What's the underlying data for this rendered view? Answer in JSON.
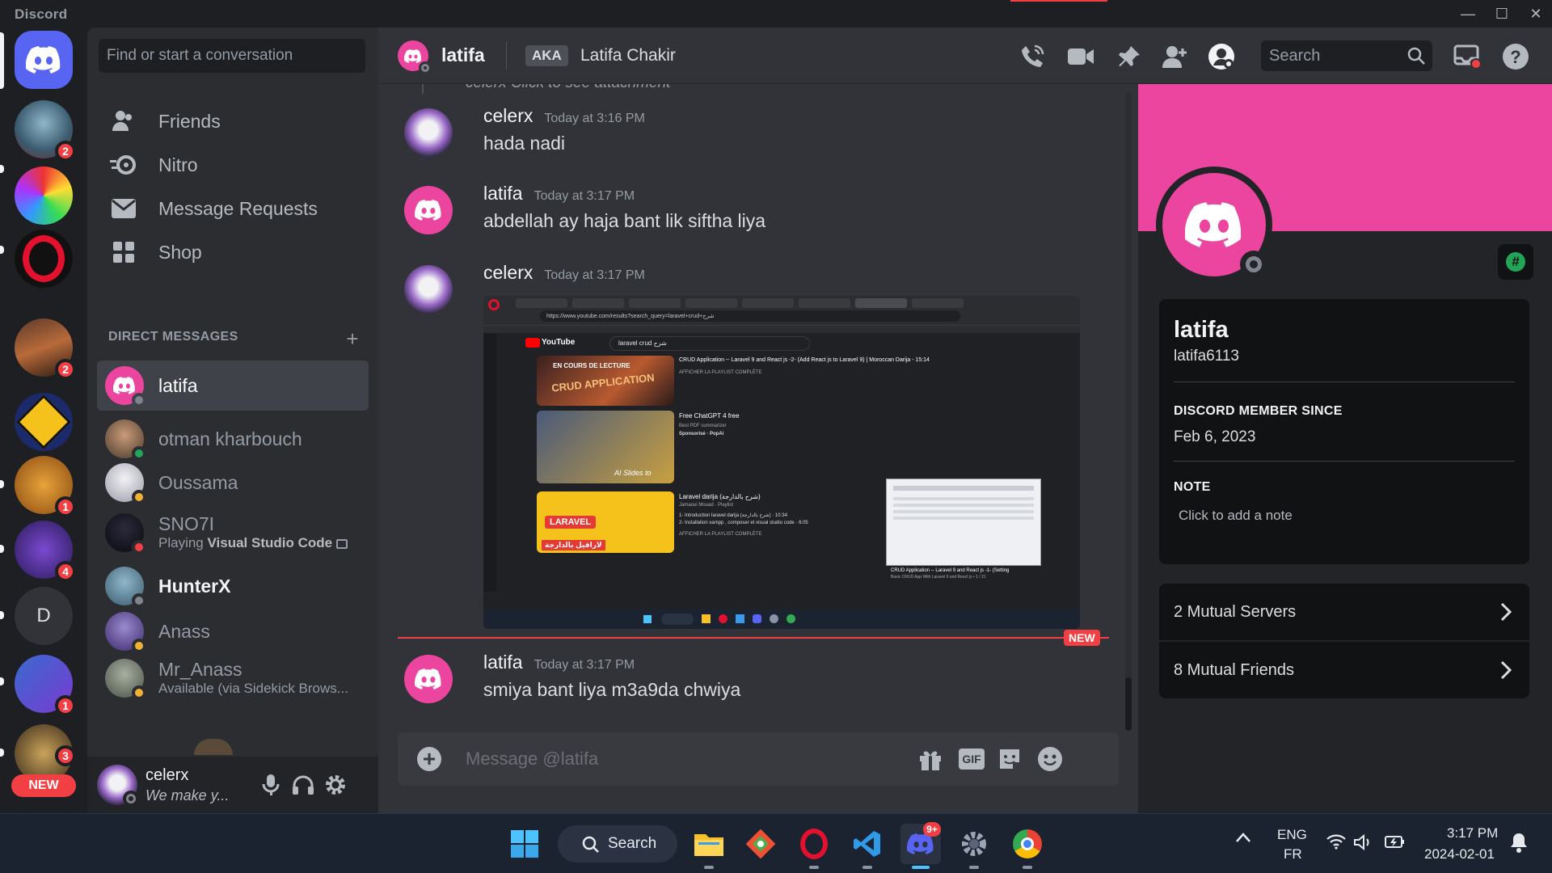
{
  "window": {
    "title": "Discord",
    "minimize": "—",
    "maximize": "☐",
    "close": "✕"
  },
  "rail": {
    "servers": [
      {
        "badge": "2"
      },
      {
        "badge": ""
      },
      {
        "badge": ""
      },
      {
        "badge": "2"
      },
      {
        "badge": ""
      },
      {
        "badge": "1"
      },
      {
        "badge": "4"
      },
      {
        "letter": "D"
      },
      {
        "badge": "1"
      },
      {
        "badge": "3"
      }
    ],
    "new_label": "NEW"
  },
  "sidebar": {
    "search_placeholder": "Find or start a conversation",
    "nav": [
      "Friends",
      "Nitro",
      "Message Requests",
      "Shop"
    ],
    "dm_header": "DIRECT MESSAGES",
    "dm_add": "+",
    "dms": [
      {
        "name": "latifa",
        "sub": ""
      },
      {
        "name": "otman kharbouch",
        "sub": ""
      },
      {
        "name": "Oussama",
        "sub": ""
      },
      {
        "name": "SNO7I",
        "sub_prefix": "Playing ",
        "sub_bold": "Visual Studio Code"
      },
      {
        "name": "HunterX",
        "sub": ""
      },
      {
        "name": "Anass",
        "sub": ""
      },
      {
        "name": "Mr_Anass",
        "sub": "Available (via Sidekick Brows..."
      }
    ]
  },
  "user_panel": {
    "name": "celerx",
    "status": "We make y..."
  },
  "header": {
    "name": "latifa",
    "aka_label": "AKA",
    "aka_name": "Latifa Chakir",
    "search_placeholder": "Search"
  },
  "messages": {
    "partial_top": "celerx  Click to see attachment",
    "items": [
      {
        "author": "celerx",
        "time": "Today at 3:16 PM",
        "text": "hada nadi"
      },
      {
        "author": "latifa",
        "time": "Today at 3:17 PM",
        "text": "abdellah ay haja bant lik siftha liya"
      },
      {
        "author": "celerx",
        "time": "Today at 3:17 PM",
        "text": ""
      },
      {
        "author": "latifa",
        "time": "Today at 3:17 PM",
        "text": "smiya bant liya m3a9da chwiya"
      }
    ],
    "new_label": "NEW"
  },
  "attachment": {
    "url": "https://www.youtube.com/results?search_query=laravel+crud+شرح",
    "search": "laravel crud شرح",
    "logo": "YouTube",
    "results": [
      {
        "title": "CRUD Application -- Laravel 9 and React js -2- (Add React js to Laravel 9) | Moroccan Darija - 15:14",
        "meta": "AFFICHER LA PLAYLIST COMPLÈTE",
        "thumb": "CRUD APPLICATION",
        "badge": "EN COURS DE LECTURE"
      },
      {
        "title": "Free ChatGPT 4 free",
        "meta": "Best PDF summarizer",
        "sponsor": "Sponsorisé · PopAi",
        "thumb": "AI Slides to"
      },
      {
        "title": "Laravel darija (شرح بالدارجة)",
        "meta": "Jamaoui Mouad · Playlist",
        "line1": "1- Introduction laravel darija (شرح بالدارجة) · 10:34",
        "line2": "2- Installation xampp , composer et visual studio code · 6:05",
        "meta2": "AFFICHER LA PLAYLIST COMPLÈTE",
        "thumb": "LARAVEL",
        "thumb_ar": "لارافيل بالدارجة"
      }
    ],
    "mini_title": "CRUD Application -- Laravel 9 and React js -1- (Setting",
    "mini_sub": "Basic CRUD App With Laravel 9 and React js • 1 / 21"
  },
  "composer": {
    "placeholder": "Message @latifa",
    "gif": "GIF"
  },
  "profile": {
    "display_name": "latifa",
    "username": "latifa6113",
    "member_since_label": "DISCORD MEMBER SINCE",
    "member_since": "Feb 6, 2023",
    "note_label": "NOTE",
    "note_placeholder": "Click to add a note",
    "mutual_servers": "2 Mutual Servers",
    "mutual_friends": "8 Mutual Friends",
    "hash": "#"
  },
  "taskbar": {
    "search": "Search",
    "discord_badge": "9+",
    "lang1": "ENG",
    "lang2": "FR",
    "time": "3:17 PM",
    "date": "2024-02-01"
  },
  "colors": {
    "blurple": "#5865f2",
    "pink": "#eb459f",
    "red": "#f23f43",
    "green": "#23a559",
    "idle": "#f0b232"
  }
}
